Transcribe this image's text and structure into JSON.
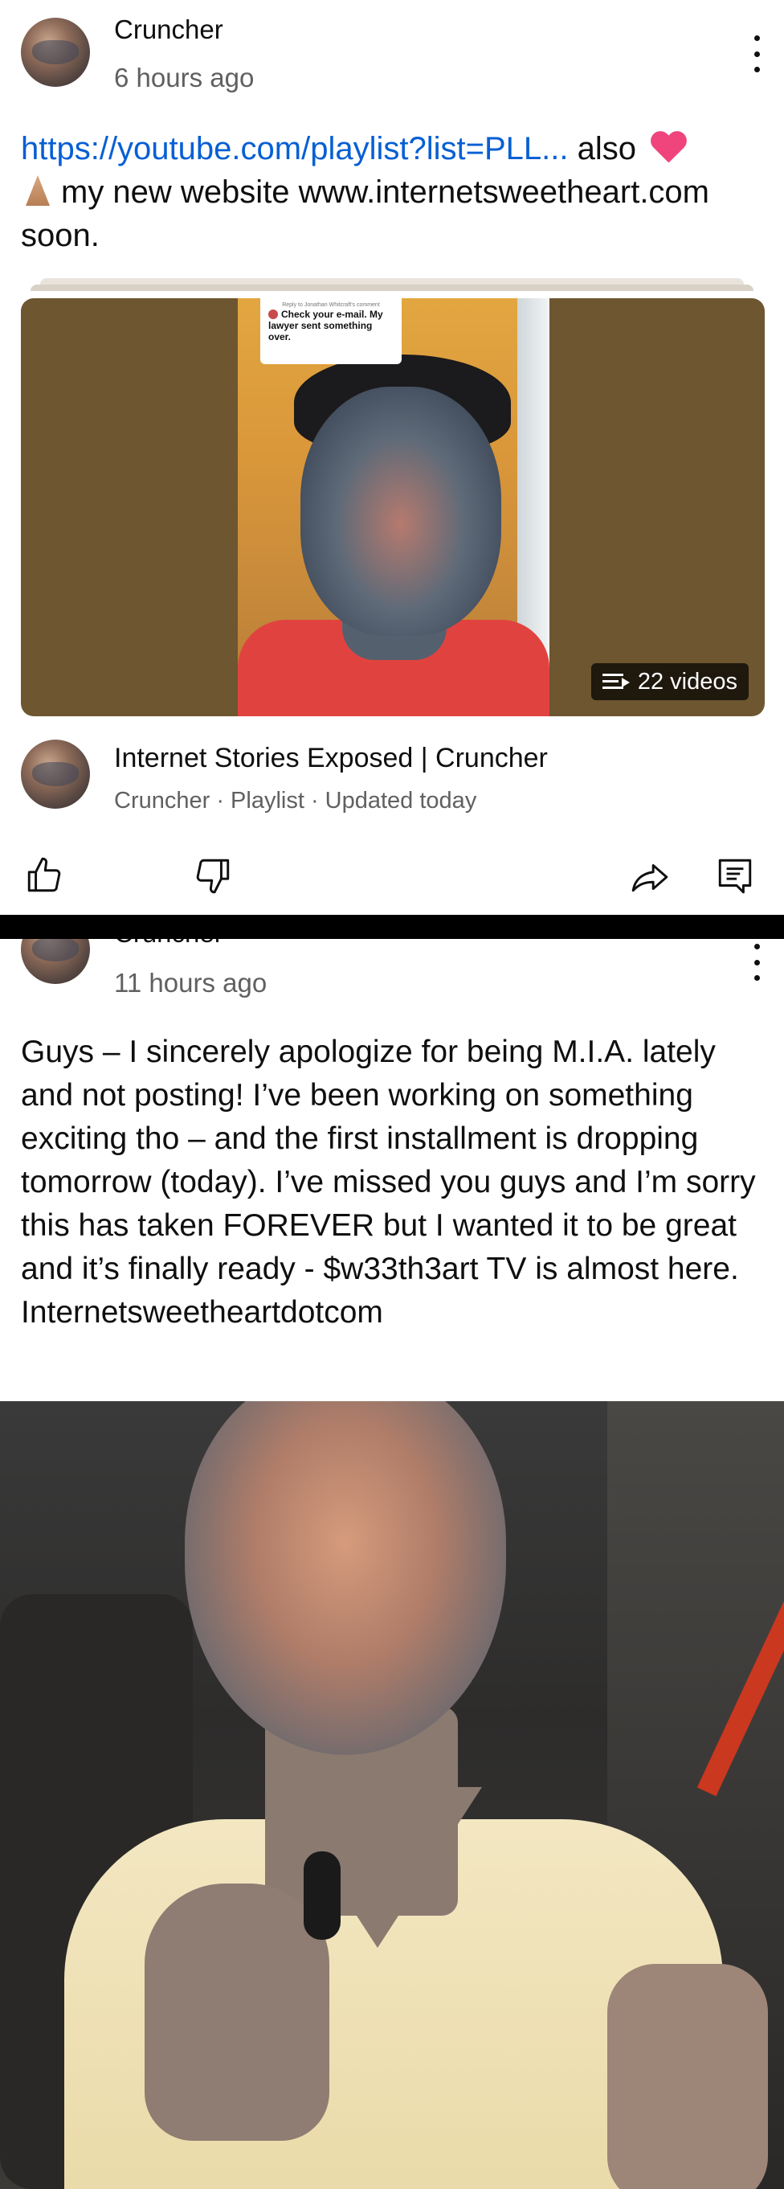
{
  "post1": {
    "author": "Cruncher",
    "time": "6 hours ago",
    "link_text": "https://youtube.com/playlist?list=PLL...",
    "text_after_link": " also ",
    "text_line2": "my new website www.internetsweetheart.com soon.",
    "heart_icon": "pink-heart-emoji",
    "hands_icon": "folded-hands-emoji",
    "thumbnail_sticker": {
      "small": "Reply to Jonathan Whitcraft's comment",
      "main": "Check your e-mail. My lawyer sent something over."
    },
    "video_count": "22 videos",
    "playlist": {
      "title": "Internet Stories Exposed | Cruncher",
      "meta": "Cruncher · Playlist · Updated today"
    }
  },
  "post2": {
    "author": "Cruncher",
    "time": "11 hours ago",
    "text": "Guys – I sincerely apologize for being M.I.A. lately and not posting! I’ve been working on something exciting tho – and the first installment is dropping tomorrow (today). I’ve missed you guys and I’m sorry this has taken FOREVER but I wanted it to be great and it’s finally ready - $w33th3art TV is almost here. Internetsweetheartdotcom"
  },
  "colors": {
    "link": "#065fd4",
    "secondary_text": "#606060",
    "heart": "#f0447c",
    "divider": "#000000"
  }
}
